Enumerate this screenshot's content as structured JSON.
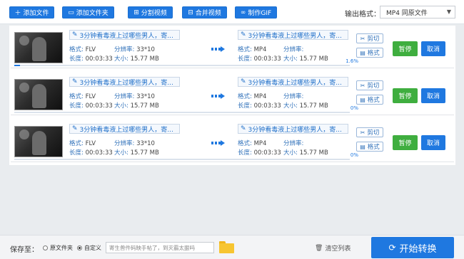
{
  "toolbar": {
    "add_file": "添加文件",
    "add_folder": "添加文件夹",
    "split_video": "分割视频",
    "merge_video": "合并视频",
    "make_gif": "制作GIF",
    "output_format_label": "输出格式：",
    "output_format_value": "MP4 同原文件"
  },
  "labels": {
    "format": "格式:",
    "resolution": "分辨率:",
    "duration": "长度:",
    "size": "大小:",
    "cut": "剪切",
    "fmt": "格式",
    "pause": "暂停",
    "cancel": "取消"
  },
  "tasks": [
    {
      "name": "3分钟看毒液上过哪些男人，寄...",
      "src_format": "FLV",
      "resolution": "33*10",
      "duration": "00:03:33",
      "size": "15.77 MB",
      "dst_format": "MP4",
      "dst_resolution": "",
      "dst_duration": "00:03:33",
      "dst_size": "15.77 MB",
      "progress_percent": 1.6,
      "progress_text": "1.6%"
    },
    {
      "name": "3分钟看毒液上过哪些男人，寄...",
      "src_format": "FLV",
      "resolution": "33*10",
      "duration": "00:03:33",
      "size": "15.77 MB",
      "dst_format": "MP4",
      "dst_resolution": "",
      "dst_duration": "00:03:33",
      "dst_size": "15.77 MB",
      "progress_percent": 0,
      "progress_text": "0%"
    },
    {
      "name": "3分钟看毒液上过哪些男人，寄...",
      "src_format": "FLV",
      "resolution": "33*10",
      "duration": "00:03:33",
      "size": "15.77 MB",
      "dst_format": "MP4",
      "dst_resolution": "",
      "dst_duration": "00:03:33",
      "dst_size": "15.77 MB",
      "progress_percent": 0,
      "progress_text": "0%"
    }
  ],
  "bottom": {
    "save_to_label": "保存至：",
    "radio_original": "原文件夹",
    "radio_custom": "自定义",
    "path_value": "寄生兽件码映手帖了，到灭霸太狠吗",
    "clear_list": "清空列表",
    "start_convert": "开始转换"
  },
  "colors": {
    "primary": "#1f78e0",
    "pause_green": "#3fae3f",
    "folder_yellow": "#f7c531"
  },
  "icons": {
    "add_file": "plus-icon",
    "add_folder": "folder-icon",
    "split": "split-icon",
    "merge": "merge-icon",
    "gif": "link-icon",
    "edit": "pencil-icon",
    "cut": "scissors-icon",
    "format": "document-icon",
    "trash": "trash-icon",
    "convert": "refresh-icon"
  }
}
